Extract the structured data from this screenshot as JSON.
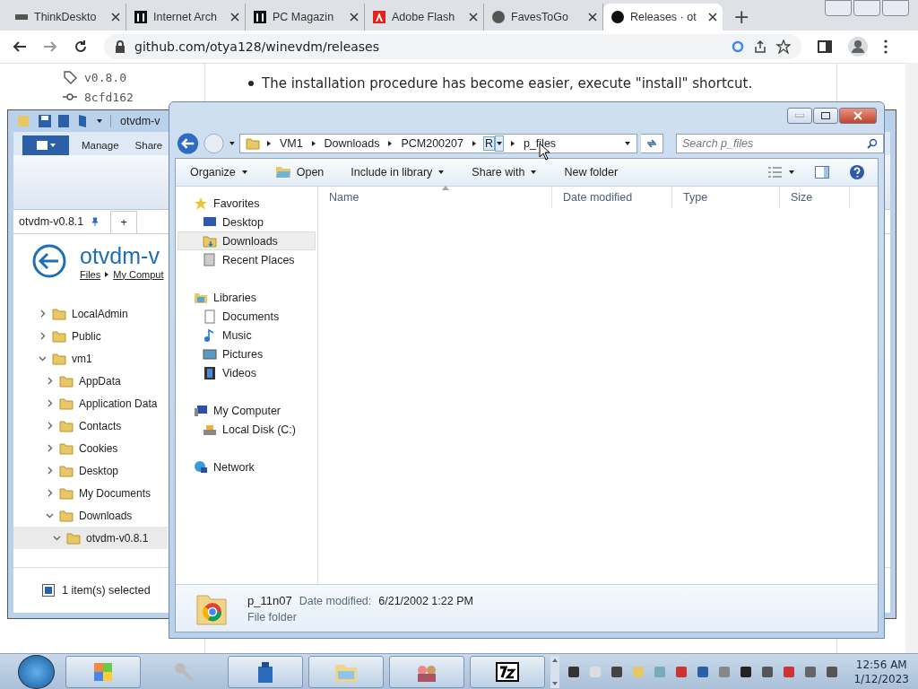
{
  "browser": {
    "tabs": [
      {
        "title": "ThinkDeskto",
        "selected": false
      },
      {
        "title": "Internet Arch",
        "selected": false
      },
      {
        "title": "PC Magazin",
        "selected": false
      },
      {
        "title": "Adobe Flash",
        "selected": false
      },
      {
        "title": "FavesToGo",
        "selected": false
      },
      {
        "title": "Releases · ot",
        "selected": true
      }
    ],
    "new_tab": "+",
    "address": "github.com/otya128/winevdm/releases"
  },
  "page": {
    "tag": "v0.8.0",
    "commit": "8cfd162",
    "bullet": "The installation procedure has become easier, execute \"install\" shortcut."
  },
  "back_window": {
    "title": "otvdm-v",
    "ribbon_tabs": [
      "Manage",
      "Share"
    ],
    "tab": "otvdm-v0.8.1",
    "new_tab": "+",
    "heading": "otvdm-v",
    "breadcrumb": [
      "Files",
      "My Comput"
    ],
    "tree": [
      {
        "label": "LocalAdmin",
        "expanded": false,
        "selected": false
      },
      {
        "label": "Public",
        "expanded": false,
        "selected": false
      },
      {
        "label": "vm1",
        "expanded": true,
        "selected": false,
        "children": [
          {
            "label": "AppData",
            "expanded": false,
            "selected": false
          },
          {
            "label": "Application Data",
            "expanded": false,
            "selected": false
          },
          {
            "label": "Contacts",
            "expanded": false,
            "selected": false
          },
          {
            "label": "Cookies",
            "expanded": false,
            "selected": false
          },
          {
            "label": "Desktop",
            "expanded": false,
            "selected": false
          },
          {
            "label": "My Documents",
            "expanded": false,
            "selected": false
          },
          {
            "label": "Downloads",
            "expanded": true,
            "selected": false,
            "children": [
              {
                "label": "otvdm-v0.8.1",
                "expanded": true,
                "selected": true
              }
            ]
          }
        ]
      }
    ],
    "status": "1 item(s) selected"
  },
  "explorer": {
    "path": [
      {
        "label": "VM1",
        "hovered": false
      },
      {
        "label": "Downloads",
        "hovered": false
      },
      {
        "label": "PCM200207",
        "hovered": false
      },
      {
        "label": "R",
        "hovered": true
      },
      {
        "label": "p_files",
        "hovered": false
      }
    ],
    "search_placeholder": "Search p_files",
    "toolbar": [
      {
        "label": "Organize",
        "menu": true
      },
      {
        "label": "Open",
        "menu": false
      },
      {
        "label": "Include in library",
        "menu": true
      },
      {
        "label": "Share with",
        "menu": true
      },
      {
        "label": "New folder",
        "menu": false
      }
    ],
    "columns": [
      "Name",
      "Date modified",
      "Type",
      "Size"
    ],
    "nav": [
      {
        "label": "Favorites",
        "items": [
          {
            "label": "Desktop",
            "selected": false
          },
          {
            "label": "Downloads",
            "selected": true
          },
          {
            "label": "Recent Places",
            "selected": false
          }
        ]
      },
      {
        "label": "Libraries",
        "items": [
          {
            "label": "Documents",
            "selected": false
          },
          {
            "label": "Music",
            "selected": false
          },
          {
            "label": "Pictures",
            "selected": false
          },
          {
            "label": "Videos",
            "selected": false
          }
        ]
      },
      {
        "label": "My Computer",
        "items": [
          {
            "label": "Local Disk (C:)",
            "selected": false
          }
        ]
      },
      {
        "label": "Network"
      }
    ],
    "details": {
      "name": "p_11n07",
      "date_label": "Date modified:",
      "date": "6/21/2002 1:22 PM",
      "type": "File folder"
    }
  },
  "taskbar": {
    "time": "12:56 AM",
    "date": "1/12/2023"
  }
}
